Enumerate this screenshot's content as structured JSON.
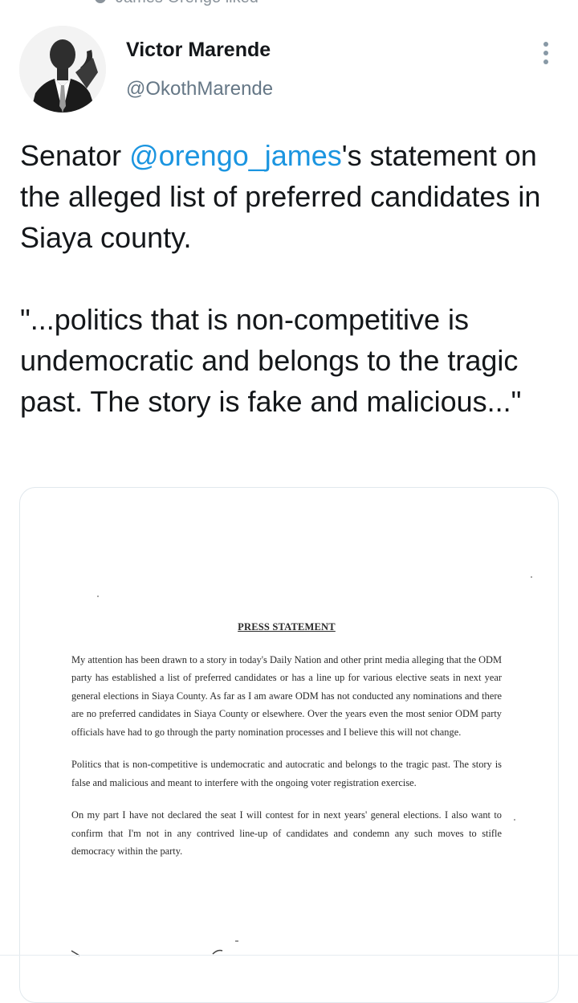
{
  "social_context": {
    "text": "James Orengo liked"
  },
  "author": {
    "name": "Victor Marende",
    "handle": "@OkothMarende"
  },
  "tweet": {
    "text_before_mention": "Senator ",
    "mention": "@orengo_james",
    "text_after_mention": "'s statement on the alleged list of preferred candidates in Siaya county.",
    "quote": "\"...politics that is non-competitive is undemocratic and belongs to the tragic past. The story is fake and malicious...\""
  },
  "media": {
    "title": "PRESS STATEMENT",
    "paragraphs": [
      "My attention has been drawn to a story in today's Daily Nation and other print media alleging that the ODM party has established a list of preferred candidates or has a line up for various elective seats in next year general elections in Siaya County. As far as I am aware ODM has not conducted any nominations and there are no preferred candidates in Siaya County or elsewhere. Over the years even the most senior ODM party officials have had to go through the party nomination processes and I believe this will not change.",
      "Politics that is non-competitive is undemocratic and autocratic and belongs to the tragic past. The story is false and malicious and meant to interfere with the ongoing voter registration exercise.",
      "On my part I have not declared the seat I will contest for in next years' general elections. I also want to confirm that I'm not in any contrived line-up of candidates and condemn any such moves to stifle democracy within the party."
    ]
  },
  "colors": {
    "link": "#1b95e0",
    "secondary_text": "#657786",
    "primary_text": "#14171a"
  }
}
